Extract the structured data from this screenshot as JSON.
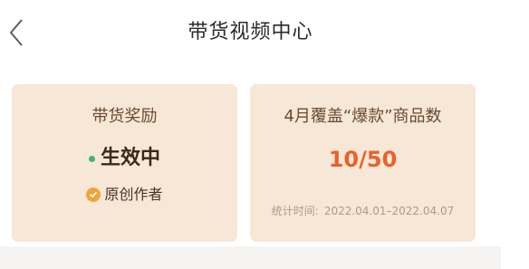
{
  "header": {
    "title": "带货视频中心",
    "back_icon": "chevron-left-icon"
  },
  "reward_card": {
    "title": "带货奖励",
    "status": "生效中",
    "status_color": "#3fb86c",
    "badge_icon": "check-badge-icon",
    "badge_label": "原创作者"
  },
  "coverage_card": {
    "title": "4月覆盖“爆款”商品数",
    "count": "10/50",
    "count_color": "#e8612c",
    "stat_label": "统计时间:",
    "date_range": "2022.04.01–2022.04.07"
  },
  "colors": {
    "card_background": "#f7e7d6",
    "page_background": "#f5f4f2"
  }
}
